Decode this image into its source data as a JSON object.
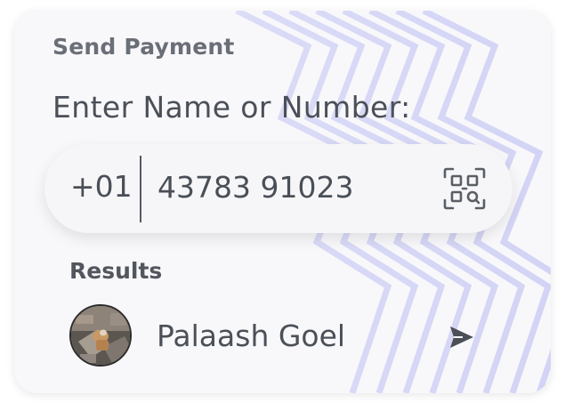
{
  "card": {
    "title": "Send Payment",
    "prompt": "Enter Name or Number:"
  },
  "phone": {
    "country_code": "+01",
    "number": "43783 91023",
    "qr_icon": "qr-scan-icon"
  },
  "results": {
    "label": "Results",
    "items": [
      {
        "name": "Palaash Goel",
        "avatar_icon": "avatar",
        "action_icon": "send-icon"
      }
    ]
  },
  "colors": {
    "card_bg": "#f8f8fb",
    "accent_lines": "#c9cbf4",
    "text": "#4b5058",
    "title_text": "#6a6e76"
  }
}
